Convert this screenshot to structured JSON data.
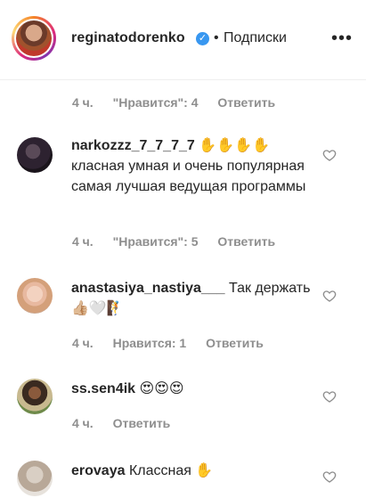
{
  "header": {
    "username": "reginatodorenko",
    "separator": "•",
    "follow_status": "Подписки",
    "more_label": "•••"
  },
  "top_meta": {
    "time": "4 ч.",
    "likes": "\"Нравится\": 4",
    "reply": "Ответить"
  },
  "comments": [
    {
      "user": "narkozzz_7_7_7_7",
      "text": " ✋✋✋✋ класная умная и очень популярная самая лучшая ведущая программы",
      "time": "4 ч.",
      "likes": "\"Нравится\": 5",
      "reply": "Ответить"
    },
    {
      "user": "anastasiya_nastiya___",
      "text": " Так держать👍🏼🤍🧗",
      "time": "4 ч.",
      "likes": "Нравится: 1",
      "reply": "Ответить"
    },
    {
      "user": "ss.sen4ik",
      "text": " 😍😍😍",
      "time": "4 ч.",
      "likes": "",
      "reply": "Ответить"
    },
    {
      "user": "erovaya",
      "text": " Классная ✋",
      "time": "",
      "likes": "",
      "reply": ""
    }
  ]
}
